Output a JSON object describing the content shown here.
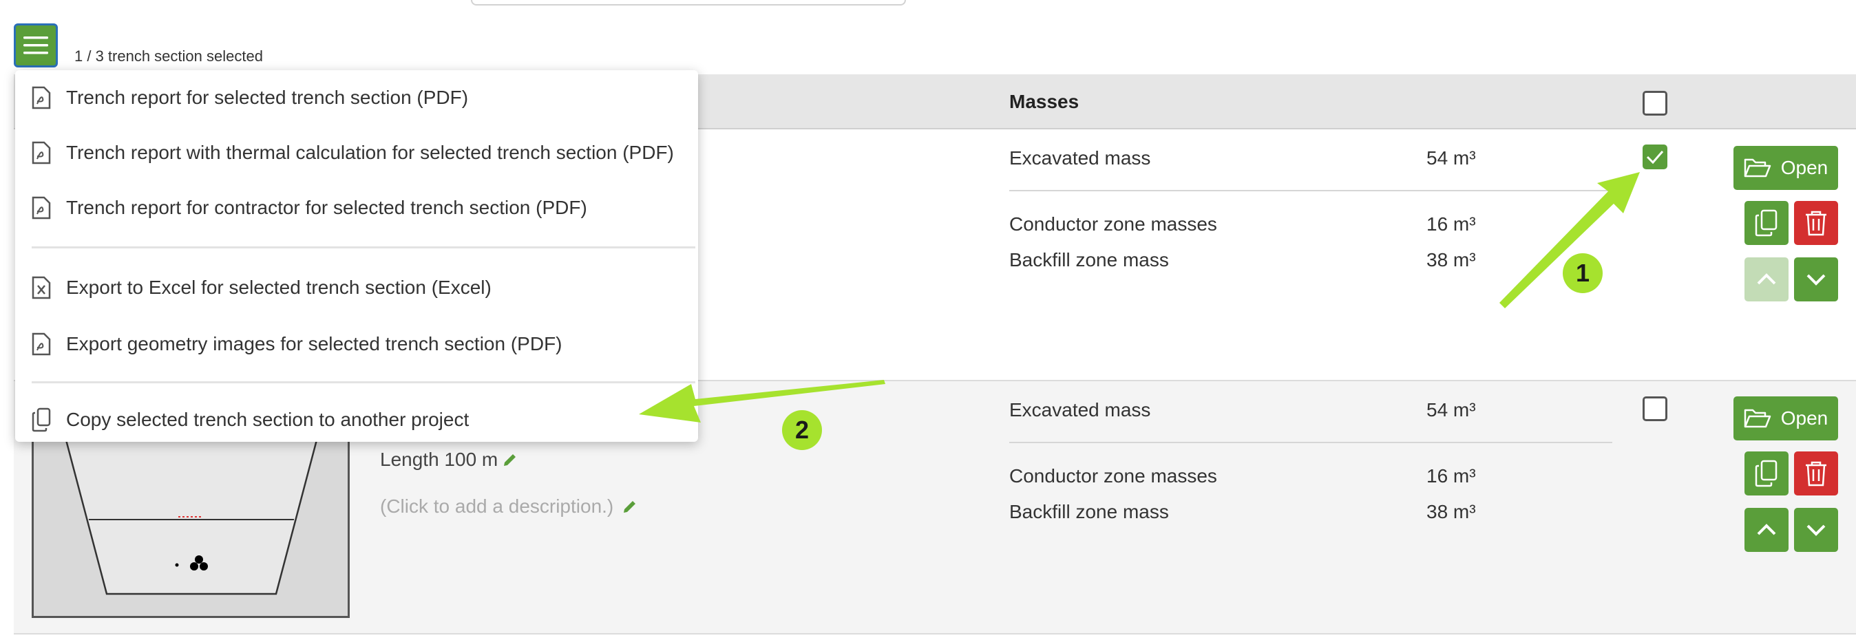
{
  "toolbar": {
    "selection_status": "1 / 3 trench section selected"
  },
  "menu": {
    "items": [
      {
        "label": "Trench report for selected trench section (PDF)",
        "icon": "pdf-file-icon"
      },
      {
        "label": "Trench report with thermal calculation for selected trench section (PDF)",
        "icon": "pdf-file-icon"
      },
      {
        "label": "Trench report for contractor for selected trench section (PDF)",
        "icon": "pdf-file-icon"
      },
      {
        "label": "Export to Excel for selected trench section (Excel)",
        "icon": "excel-file-icon"
      },
      {
        "label": "Export geometry images for selected trench section (PDF)",
        "icon": "pdf-file-icon"
      },
      {
        "label": "Copy selected trench section to another project",
        "icon": "copy-icon"
      }
    ]
  },
  "table": {
    "masses_header": "Masses",
    "rows": [
      {
        "selected": true,
        "excavated_label": "Excavated mass",
        "excavated_value": "54 m³",
        "conductor_label": "Conductor zone masses",
        "conductor_value": "16 m³",
        "backfill_label": "Backfill zone mass",
        "backfill_value": "38 m³",
        "open_label": "Open"
      },
      {
        "selected": false,
        "length": "Length 100 m",
        "description_placeholder": "(Click to add a description.)",
        "excavated_label": "Excavated mass",
        "excavated_value": "54 m³",
        "conductor_label": "Conductor zone masses",
        "conductor_value": "16 m³",
        "backfill_label": "Backfill zone mass",
        "backfill_value": "38 m³",
        "open_label": "Open"
      }
    ]
  },
  "annotations": {
    "badge_1": "1",
    "badge_2": "2"
  },
  "colors": {
    "primary_green": "#5a9e3a",
    "delete_red": "#d42f2f",
    "annotation_lime": "#a6e22e",
    "focus_blue": "#2a6fb8"
  }
}
